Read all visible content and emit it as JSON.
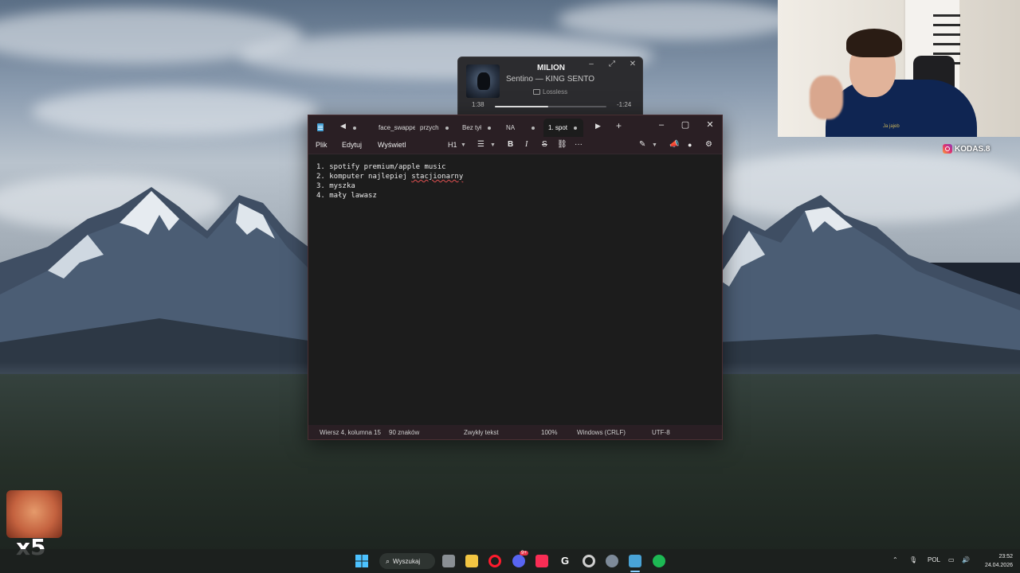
{
  "media": {
    "title": "MILION",
    "artist": "Sentino — KING SENTO I",
    "badge": "Lossless",
    "elapsed": "1:38",
    "remaining": "-1:24",
    "progress": 0.48,
    "controls": {
      "minimize": "–",
      "expand": "⤢",
      "close": "✕"
    }
  },
  "notepad": {
    "tabs": [
      {
        "label": "face_swappe"
      },
      {
        "label": "przych"
      },
      {
        "label": "Bez tył"
      },
      {
        "label": "NA"
      },
      {
        "label": "1. spot",
        "active": true
      }
    ],
    "new_tab": "+",
    "menu": [
      "Plik",
      "Edytuj",
      "Wyświetl"
    ],
    "toolbar": {
      "heading": "H1",
      "bold": "B",
      "italic": "I",
      "strike": "S",
      "more": "···"
    },
    "window_buttons": {
      "minimize": "–",
      "maximize": "▢",
      "close": "✕"
    },
    "lines": [
      {
        "num": "1.",
        "text": "spotify premium/apple music",
        "misspelled": ""
      },
      {
        "num": "2.",
        "text": "komputer najlepiej ",
        "misspelled": "stacjionarny"
      },
      {
        "num": "3.",
        "text": "myszka",
        "misspelled": ""
      },
      {
        "num": "4.",
        "text": "mały lawasz",
        "misspelled": ""
      }
    ],
    "status": {
      "position": "Wiersz 4, kolumna 15",
      "chars": "90 znaków",
      "format": "Zwykły tekst",
      "zoom": "100%",
      "line_endings": "Windows (CRLF)",
      "encoding": "UTF-8"
    }
  },
  "overlay": {
    "instagram": "KODAS.8",
    "shirt_text": "Ja jajeb",
    "sticker_label": "x5"
  },
  "taskbar": {
    "search_label": "Wyszukaj",
    "apps": [
      "windows-start",
      "file-explorer",
      "opera-browser",
      "discord",
      "apple-music",
      "app-g",
      "obs-studio",
      "settings",
      "notepad",
      "spotify"
    ],
    "discord_badge": "9+",
    "language": "POL",
    "time": "23:52",
    "date": "24.04.2026"
  },
  "colors": {
    "accent": "#d04a6a",
    "notepad_chrome": "#2a1f24",
    "spotify": "#1db954",
    "apple_music": "#fa2d55"
  }
}
